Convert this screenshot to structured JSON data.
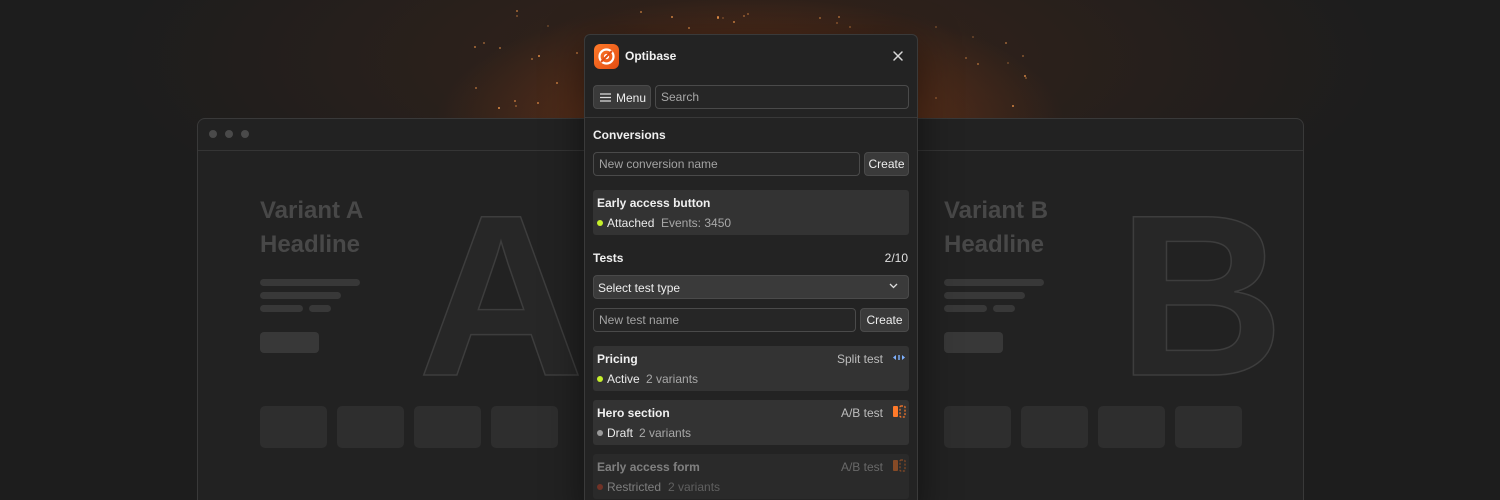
{
  "app": {
    "title": "Optibase",
    "close_icon": "close-icon",
    "logo_icon": "optibase-logo-icon"
  },
  "toolbar": {
    "menu_label": "Menu",
    "menu_icon": "hamburger-icon",
    "search_placeholder": "Search"
  },
  "conversions": {
    "title": "Conversions",
    "input_placeholder": "New conversion name",
    "create_label": "Create",
    "items": [
      {
        "name": "Early access button",
        "status": "Attached",
        "meta": "Events: 3450",
        "status_color": "#c6f02b"
      }
    ]
  },
  "tests": {
    "title": "Tests",
    "count": "2/10",
    "select_label": "Select test type",
    "input_placeholder": "New test name",
    "create_label": "Create",
    "items": [
      {
        "name": "Pricing",
        "type": "Split test",
        "status": "Active",
        "meta": "2 variants",
        "status_color": "#c6f02b",
        "type_color": "#7fb2ff"
      },
      {
        "name": "Hero section",
        "type": "A/B test",
        "status": "Draft",
        "meta": "2 variants",
        "status_color": "#9a9a9a",
        "type_color": "#ff7a2a"
      },
      {
        "name": "Early access form",
        "type": "A/B test",
        "status": "Restricted",
        "meta": "2 variants",
        "status_color": "#d0462a",
        "type_color": "#ff7a2a"
      }
    ]
  },
  "background": {
    "variant_a": {
      "line1": "Variant A",
      "line2": "Headline",
      "letter": "A"
    },
    "variant_b": {
      "line1": "Variant B",
      "line2": "Headline",
      "letter": "B"
    }
  },
  "colors": {
    "accent": "#ff7a2a",
    "glow": "#d6601e",
    "panel_bg": "#232323"
  }
}
